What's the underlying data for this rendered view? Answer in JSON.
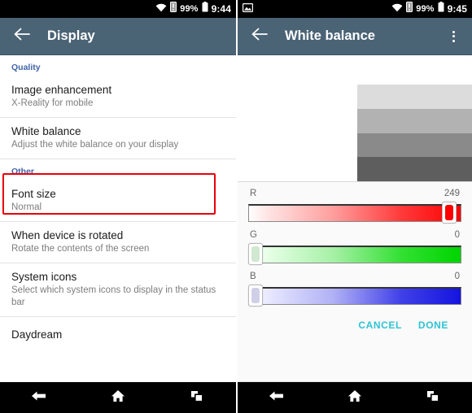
{
  "colors": {
    "toolbar": "#4a6375",
    "section_header": "#3f63a8",
    "highlight_border": "#e8000b",
    "accent_action": "#2ec4d4",
    "navbar": "#000000",
    "statusbar": "#000000"
  },
  "left_screen": {
    "statusbar": {
      "battery_percent": "99%",
      "time": "9:44",
      "icons": [
        "wifi-icon",
        "sim-card-icon",
        "battery-icon"
      ]
    },
    "toolbar": {
      "back_icon": "arrow-left-icon",
      "title": "Display"
    },
    "sections": [
      {
        "header": "Quality",
        "rows": [
          {
            "title": "Image enhancement",
            "subtitle": "X-Reality for mobile",
            "highlighted": false
          },
          {
            "title": "White balance",
            "subtitle": "Adjust the white balance on your display",
            "highlighted": true
          }
        ]
      },
      {
        "header": "Other",
        "rows": [
          {
            "title": "Font size",
            "subtitle": "Normal",
            "highlighted": false
          },
          {
            "title": "When device is rotated",
            "subtitle": "Rotate the contents of the screen",
            "highlighted": false
          },
          {
            "title": "System icons",
            "subtitle": "Select which system icons to display in the status bar",
            "highlighted": false
          },
          {
            "title": "Daydream",
            "subtitle": "",
            "highlighted": false
          }
        ]
      }
    ],
    "navbar": {
      "back_label": "back-icon",
      "home_label": "home-icon",
      "recents_label": "recents-icon"
    }
  },
  "right_screen": {
    "statusbar": {
      "left_icon": "screenshot-image-icon",
      "battery_percent": "99%",
      "time": "9:45",
      "icons": [
        "wifi-icon",
        "sim-card-icon",
        "battery-icon"
      ]
    },
    "toolbar": {
      "back_icon": "arrow-left-icon",
      "title": "White balance",
      "overflow_icon": "overflow-menu-icon"
    },
    "preview": {
      "name": "white-balance-preview",
      "bands": [
        "#dcdcdc",
        "#b2b2b2",
        "#8a8a8a",
        "#5e5e5e"
      ]
    },
    "sliders": [
      {
        "id": "r",
        "label": "R",
        "value": "249",
        "value_num": 249,
        "max": 255,
        "percent": 97.6
      },
      {
        "id": "g",
        "label": "G",
        "value": "0",
        "value_num": 0,
        "max": 255,
        "percent": 0
      },
      {
        "id": "b",
        "label": "B",
        "value": "0",
        "value_num": 0,
        "max": 255,
        "percent": 0
      }
    ],
    "actions": {
      "cancel": "CANCEL",
      "done": "DONE"
    },
    "navbar": {
      "back_label": "back-icon",
      "home_label": "home-icon",
      "recents_label": "recents-icon"
    }
  }
}
